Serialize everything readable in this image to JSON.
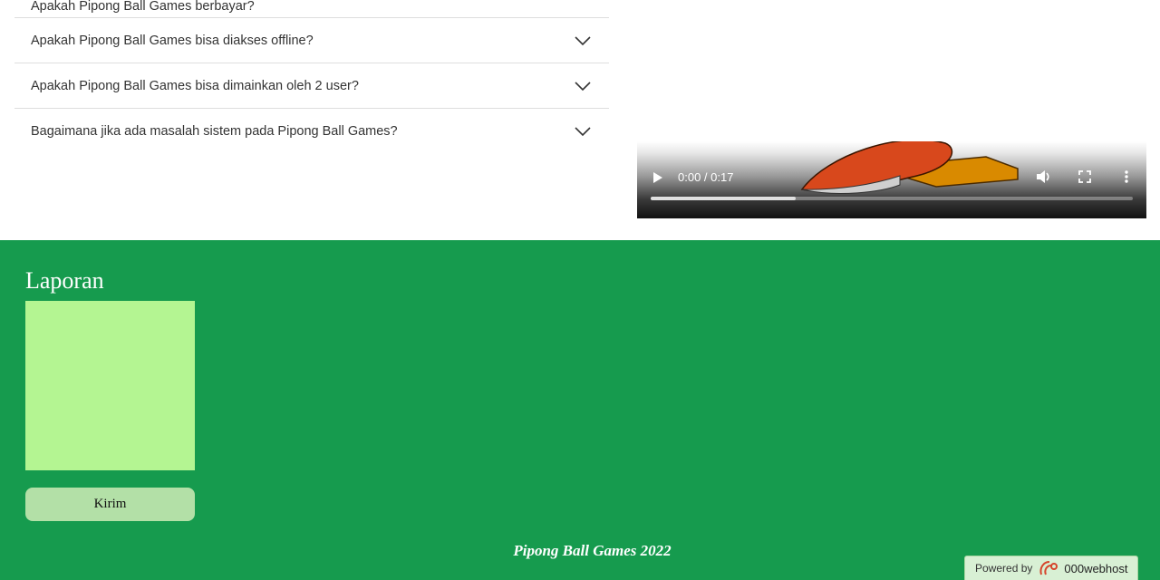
{
  "faq": {
    "items": [
      {
        "question": "Apakah Pipong Ball Games berbayar?"
      },
      {
        "question": "Apakah Pipong Ball Games bisa diakses offline?"
      },
      {
        "question": "Apakah Pipong Ball Games bisa dimainkan oleh 2 user?"
      },
      {
        "question": "Bagaimana jika ada masalah sistem pada Pipong Ball Games?"
      }
    ],
    "chevron_icon": "chevron-down-icon"
  },
  "video": {
    "time": "0:00 / 0:17",
    "buffered_fraction": 0.3,
    "icons": [
      "play-icon",
      "volume-icon",
      "fullscreen-icon",
      "more-options-icon"
    ]
  },
  "report": {
    "title": "Laporan",
    "textarea_value": "",
    "send_label": "Kirim"
  },
  "footer": {
    "text": "Pipong Ball Games 2022",
    "powered_label": "Powered by",
    "powered_brand": "000webhost"
  },
  "colors": {
    "footer_bg": "#169b4e",
    "textarea_bg": "#b4f592",
    "button_bg": "#b3e0a7"
  }
}
